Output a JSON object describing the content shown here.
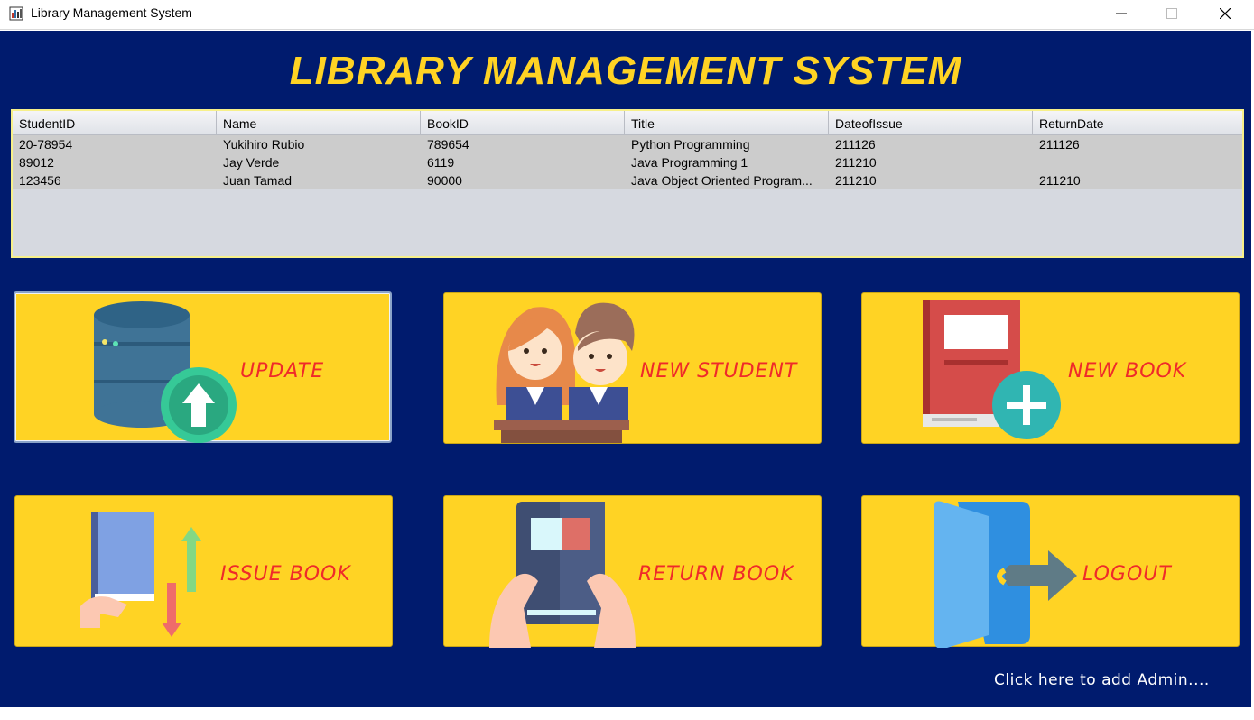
{
  "window": {
    "title": "Library Management System",
    "controls": [
      "minimize",
      "maximize",
      "close"
    ]
  },
  "heading": "LIBRARY MANAGEMENT SYSTEM",
  "colors": {
    "background": "#001b6e",
    "heading": "#ffd324",
    "tile": "#ffd324",
    "tile_label": "#ef2a2a",
    "table_border": "#f7f08a"
  },
  "table": {
    "columns": [
      "StudentID",
      "Name",
      "BookID",
      "Title",
      "DateofIssue",
      "ReturnDate"
    ],
    "rows": [
      [
        "20-78954",
        "Yukihiro Rubio",
        "789654",
        "Python Programming",
        "211126",
        "211126"
      ],
      [
        "89012",
        "Jay Verde",
        "6119",
        "Java Programming 1",
        "211210",
        ""
      ],
      [
        "123456",
        "Juan Tamad",
        "90000",
        "Java Object Oriented Program...",
        "211210",
        "211210"
      ]
    ]
  },
  "buttons": {
    "update": {
      "label": "UPDATE",
      "icon": "database-upload-icon"
    },
    "new_student": {
      "label": "NEW STUDENT",
      "icon": "students-icon"
    },
    "new_book": {
      "label": "NEW BOOK",
      "icon": "book-add-icon"
    },
    "issue_book": {
      "label": "ISSUE BOOK",
      "icon": "book-transfer-icon"
    },
    "return_book": {
      "label": "RETURN BOOK",
      "icon": "book-in-hands-icon"
    },
    "logout": {
      "label": "LOGOUT",
      "icon": "door-exit-icon"
    }
  },
  "admin_link": "Click here to add Admin...."
}
